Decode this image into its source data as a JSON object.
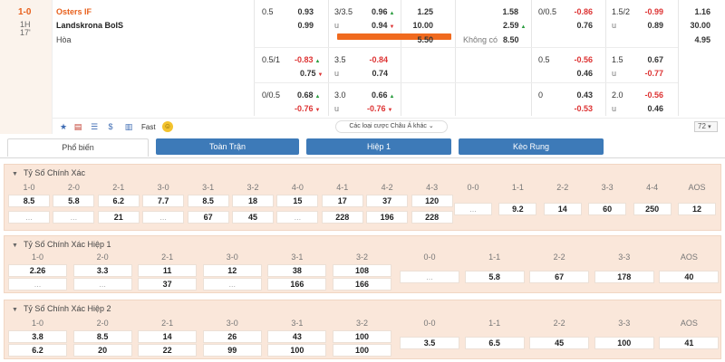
{
  "match": {
    "score": "1-0",
    "half": "1H",
    "minute": "17'",
    "home": "Osters IF",
    "away": "Landskrona BoIS",
    "draw": "Hòa"
  },
  "odds": {
    "row1": {
      "hdp_line": "0.5",
      "hdp_home": "0.93",
      "hdp_away": "0.99",
      "ou_line": "3/3.5",
      "ou_over": "0.96",
      "ou_u": "u",
      "ou_under": "0.94",
      "x12_home": "1.25",
      "x12_away": "10.00",
      "x12_draw": "5.50",
      "x2_home": "1.58",
      "x2_away": "2.59",
      "x2_none_label": "Không có",
      "x2_none": "8.50",
      "h1_hdp_line": "0/0.5",
      "h1_hdp_home": "-0.86",
      "h1_hdp_away": "0.76",
      "h1_ou_line": "1.5/2",
      "h1_ou_over": "-0.99",
      "h1_ou_u": "u",
      "h1_ou_under": "0.89",
      "h1_x12_home": "1.16",
      "h1_x12_away": "30.00",
      "h1_x12_draw": "4.95"
    },
    "row2": {
      "hdp_line": "0.5/1",
      "hdp_home": "-0.83",
      "hdp_away": "0.75",
      "ou_line": "3.5",
      "ou_over": "-0.84",
      "ou_u": "u",
      "ou_under": "0.74",
      "h1_hdp_line": "0.5",
      "h1_hdp_home": "-0.56",
      "h1_hdp_away": "0.46",
      "h1_ou_line": "1.5",
      "h1_ou_over": "0.67",
      "h1_ou_u": "u",
      "h1_ou_under": "-0.77"
    },
    "row3": {
      "hdp_line": "0/0.5",
      "hdp_home": "0.68",
      "hdp_away": "-0.76",
      "ou_line": "3.0",
      "ou_over": "0.66",
      "ou_u": "u",
      "ou_under": "-0.76",
      "h1_hdp_line": "0",
      "h1_hdp_home": "0.43",
      "h1_hdp_away": "-0.53",
      "h1_ou_line": "2.0",
      "h1_ou_over": "-0.56",
      "h1_ou_u": "u",
      "h1_ou_under": "0.46"
    }
  },
  "toolbar": {
    "icons": [
      "star-icon",
      "table-icon",
      "list-icon",
      "dollar-icon",
      "chart-icon"
    ],
    "fast_label": "Fast",
    "more_label": "Các loại cược Châu Á khác",
    "count": "72"
  },
  "tabs": [
    "Phổ biến",
    "Toàn Trận",
    "Hiệp 1",
    "Kèo Rung"
  ],
  "sections": [
    {
      "title": "Tỷ Số Chính Xác",
      "left_headers": [
        "1-0",
        "2-0",
        "2-1",
        "3-0",
        "3-1",
        "3-2",
        "4-0",
        "4-1",
        "4-2",
        "4-3"
      ],
      "left_row1": [
        "8.5",
        "5.8",
        "6.2",
        "7.7",
        "8.5",
        "18",
        "15",
        "17",
        "37",
        "120"
      ],
      "left_row2": [
        "...",
        "...",
        "21",
        "...",
        "67",
        "45",
        "...",
        "228",
        "196",
        "228"
      ],
      "right_headers": [
        "0-0",
        "1-1",
        "2-2",
        "3-3",
        "4-4",
        "AOS"
      ],
      "right_values": [
        "...",
        "9.2",
        "14",
        "60",
        "250",
        "12"
      ]
    },
    {
      "title": "Tỷ Số Chính Xác Hiệp 1",
      "left_headers": [
        "1-0",
        "2-0",
        "2-1",
        "3-0",
        "3-1",
        "3-2"
      ],
      "left_row1": [
        "2.26",
        "3.3",
        "11",
        "12",
        "38",
        "108"
      ],
      "left_row2": [
        "...",
        "...",
        "37",
        "...",
        "166",
        "166"
      ],
      "right_headers": [
        "0-0",
        "1-1",
        "2-2",
        "3-3",
        "AOS"
      ],
      "right_values": [
        "...",
        "5.8",
        "67",
        "178",
        "40"
      ]
    },
    {
      "title": "Tỷ Số Chính Xác Hiệp 2",
      "left_headers": [
        "1-0",
        "2-0",
        "2-1",
        "3-0",
        "3-1",
        "3-2"
      ],
      "left_row1": [
        "3.8",
        "8.5",
        "14",
        "26",
        "43",
        "100"
      ],
      "left_row2": [
        "6.2",
        "20",
        "22",
        "99",
        "100",
        "100"
      ],
      "right_headers": [
        "0-0",
        "1-1",
        "2-2",
        "3-3",
        "AOS"
      ],
      "right_values": [
        "3.5",
        "6.5",
        "45",
        "100",
        "41"
      ]
    }
  ],
  "colors": {
    "accent_orange": "#e8601c",
    "tab_blue": "#3d7ab8",
    "section_bg": "#fae7da",
    "negative_red": "#d33333"
  }
}
